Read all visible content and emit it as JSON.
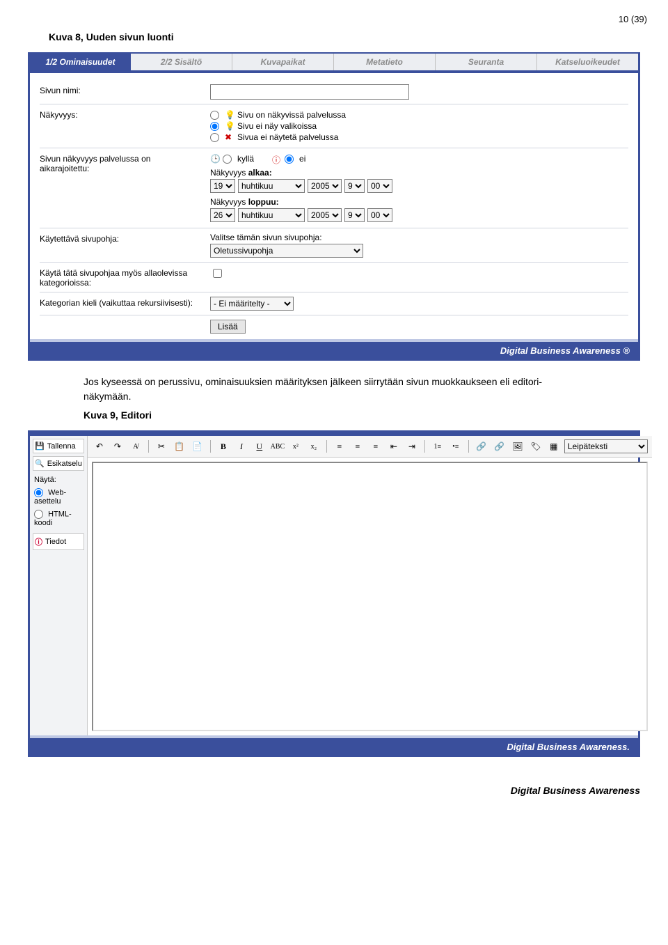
{
  "page_number": "10 (39)",
  "caption1": "Kuva 8, Uuden sivun luonti",
  "body_text": "Jos kyseessä on perussivu, ominaisuuksien määrityksen jälkeen siirrytään sivun muokkaukseen eli editori-näkymään.",
  "caption2": "Kuva 9, Editori",
  "footer": "Digital Business Awareness",
  "shot1": {
    "tabs": [
      "1/2 Ominaisuudet",
      "2/2 Sisältö",
      "Kuvapaikat",
      "Metatieto",
      "Seuranta",
      "Katseluoikeudet"
    ],
    "row_name": "Sivun nimi:",
    "row_vis": "Näkyvyys:",
    "vis_opts": [
      "Sivu on näkyvissä palvelussa",
      "Sivu ei näy valikoissa",
      "Sivua ei näytetä palvelussa"
    ],
    "row_timed1": "Sivun näkyvyys palvelussa on",
    "row_timed2": "aikarajoitettu:",
    "kylla": "kyllä",
    "ei": "ei",
    "alkaa_lbl": "Näkyvyys",
    "alkaa_bold": "alkaa:",
    "loppuu_lbl": "Näkyvyys",
    "loppuu_bold": "loppuu:",
    "start": {
      "day": "19",
      "month": "huhtikuu",
      "year": "2005",
      "h": "9",
      "m": "00"
    },
    "end": {
      "day": "26",
      "month": "huhtikuu",
      "year": "2005",
      "h": "9",
      "m": "00"
    },
    "row_tpl": "Käytettävä sivupohja:",
    "tpl_hint": "Valitse tämän sivun sivupohja:",
    "tpl_val": "Oletussivupohja",
    "row_use1": "Käytä tätä sivupohjaa myös allaolevissa",
    "row_use2": "kategorioissa:",
    "row_lang": "Kategorian kieli (vaikuttaa rekursiivisesti):",
    "lang_val": "- Ei määritelty -",
    "btn_add": "Lisää",
    "brand": "Digital Business Awareness ®"
  },
  "shot2": {
    "side": {
      "save": "Tallenna",
      "preview": "Esikatselu",
      "show": "Näytä:",
      "web": "Web-asettelu",
      "html": "HTML-koodi",
      "info": "Tiedot"
    },
    "style": "Leipäteksti",
    "brand": "Digital Business Awareness."
  }
}
